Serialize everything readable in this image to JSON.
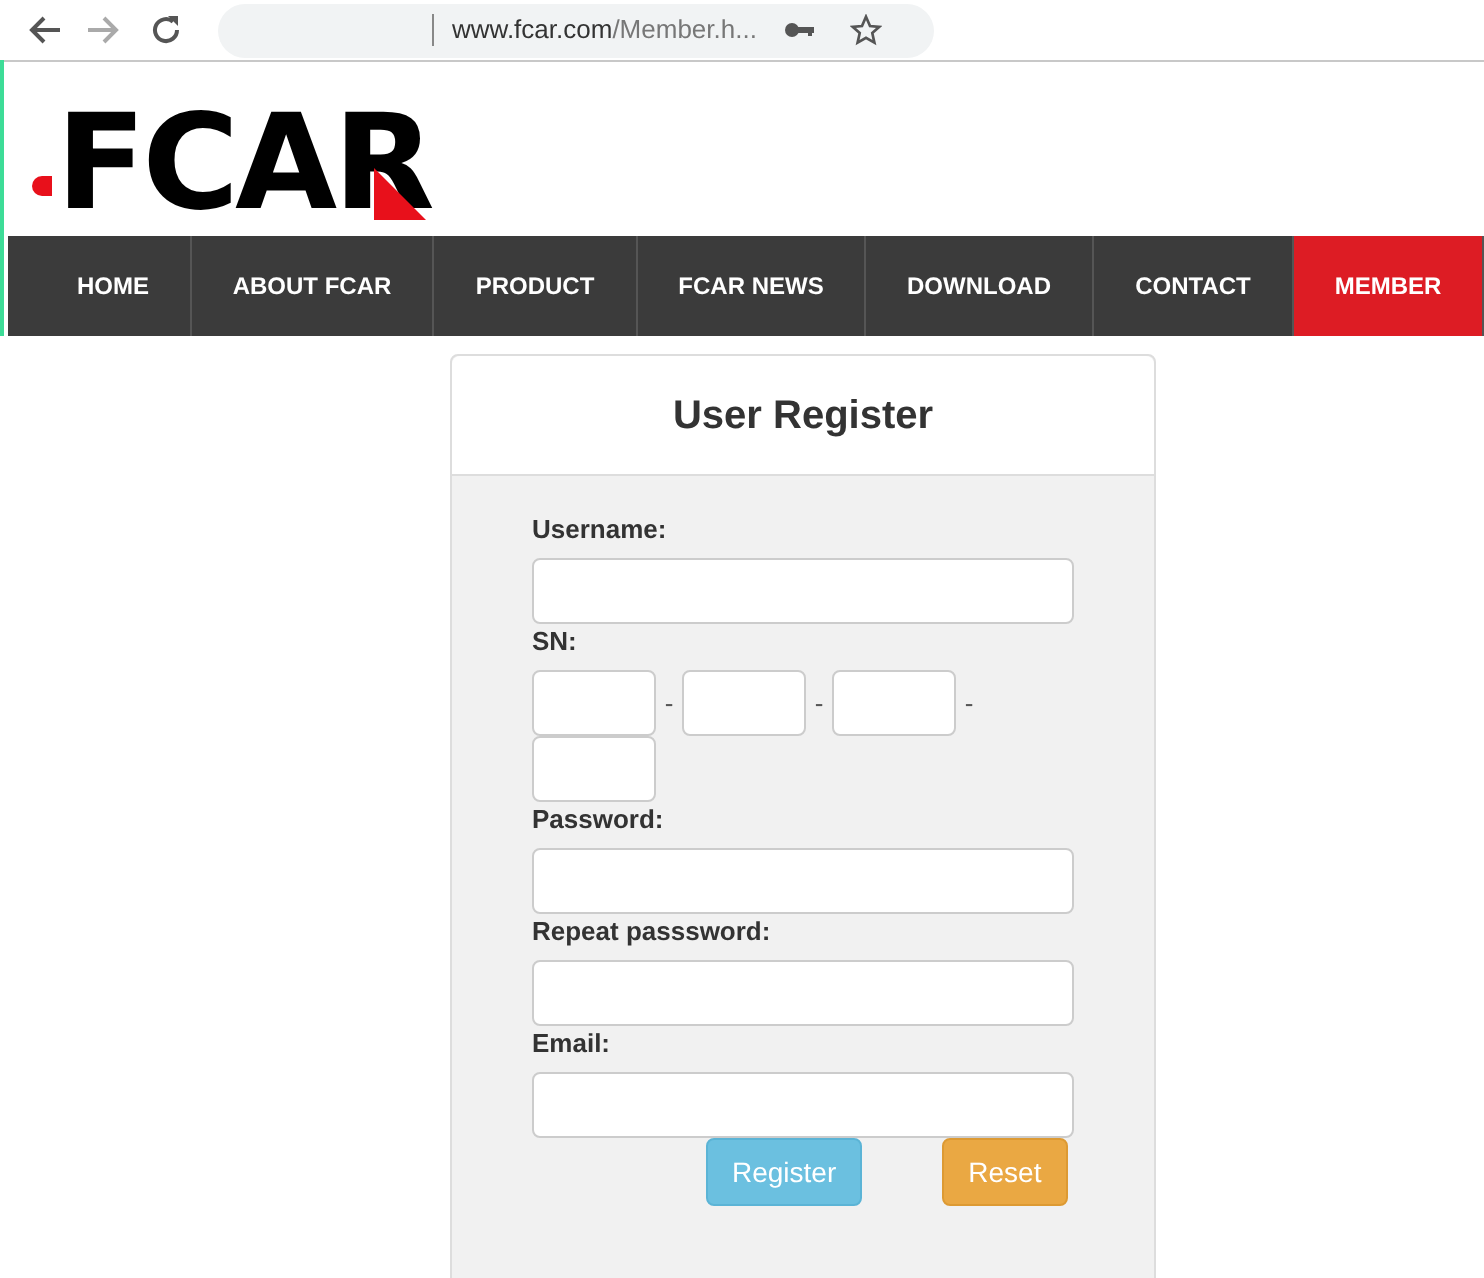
{
  "browser": {
    "url_host": "www.fcar.com",
    "url_rest": "/Member.h..."
  },
  "logo": {
    "text": "FCAR"
  },
  "nav": [
    {
      "label": "HOME",
      "selected": false
    },
    {
      "label": "ABOUT FCAR",
      "selected": false
    },
    {
      "label": "PRODUCT",
      "selected": false
    },
    {
      "label": "FCAR NEWS",
      "selected": false
    },
    {
      "label": "DOWNLOAD",
      "selected": false
    },
    {
      "label": "CONTACT",
      "selected": false
    },
    {
      "label": "MEMBER",
      "selected": true
    }
  ],
  "form": {
    "title": "User Register",
    "fields": [
      {
        "kind": "text",
        "label": "Username:"
      },
      {
        "kind": "sn",
        "label": "SN:",
        "separator": "-"
      },
      {
        "kind": "text",
        "label": "Password:"
      },
      {
        "kind": "text",
        "label": "Repeat passsword:"
      },
      {
        "kind": "text",
        "label": "Email:"
      }
    ],
    "buttons": [
      {
        "kind": "primary",
        "label": "Register"
      },
      {
        "kind": "warning",
        "label": "Reset"
      }
    ]
  }
}
